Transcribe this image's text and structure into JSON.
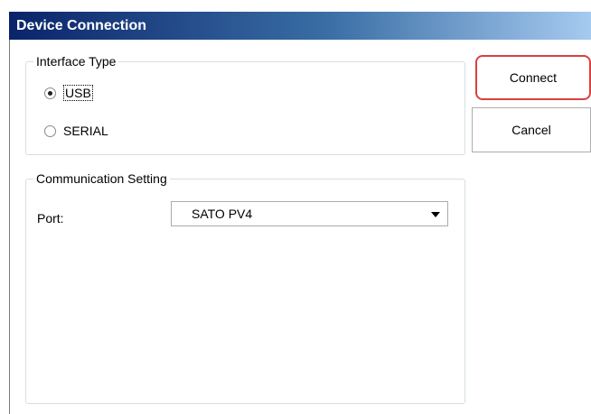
{
  "window": {
    "title": "Device Connection"
  },
  "interface_type": {
    "label": "Interface Type",
    "options": [
      {
        "label": "USB",
        "selected": true
      },
      {
        "label": "SERIAL",
        "selected": false
      }
    ]
  },
  "communication_setting": {
    "label": "Communication Setting",
    "port_label": "Port:",
    "port_value": "SATO PV4"
  },
  "buttons": {
    "connect": "Connect",
    "cancel": "Cancel"
  }
}
